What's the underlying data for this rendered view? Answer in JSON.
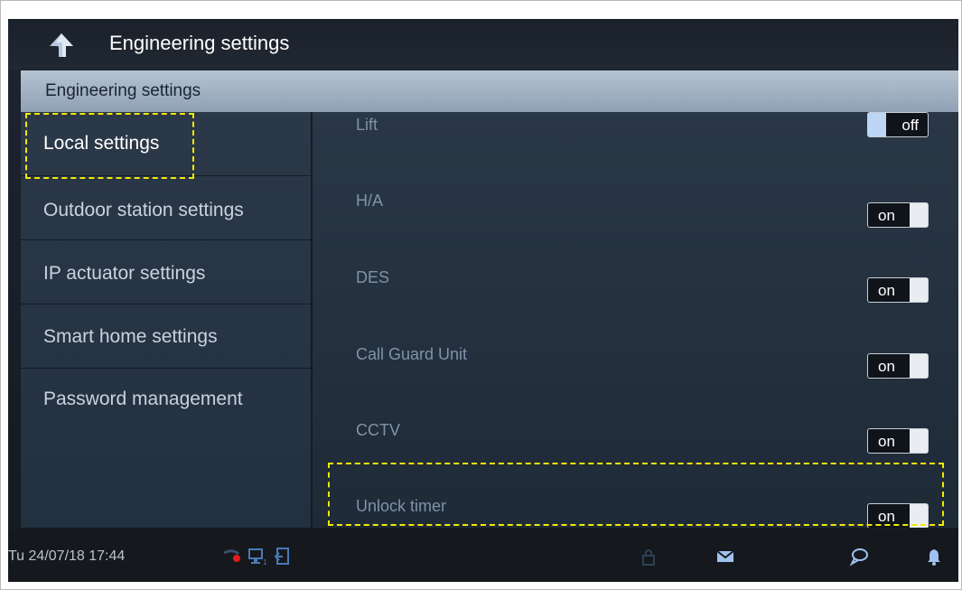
{
  "titlebar": {
    "title": "Engineering settings"
  },
  "section_header": "Engineering settings",
  "menu": {
    "items": [
      {
        "label": "Local settings",
        "active": true
      },
      {
        "label": "Outdoor station settings"
      },
      {
        "label": "IP actuator settings"
      },
      {
        "label": "Smart home settings"
      },
      {
        "label": "Password management"
      }
    ]
  },
  "settings": [
    {
      "label": "Lift",
      "state": "off"
    },
    {
      "label": "H/A",
      "state": "on"
    },
    {
      "label": "DES",
      "state": "on"
    },
    {
      "label": "Call Guard Unit",
      "state": "on"
    },
    {
      "label": "CCTV",
      "state": "on"
    },
    {
      "label": "Unlock timer",
      "state": "on"
    }
  ],
  "statusbar": {
    "datetime": "Tu 24/07/18  17:44",
    "icons": [
      "missed-call-icon",
      "monitor-1-icon",
      "door-exit-icon",
      "lock-icon",
      "message-icon",
      "chat-icon",
      "bell-icon"
    ]
  },
  "colors": {
    "highlight": "#f2e900",
    "header_bg": "#a4b4c6"
  }
}
